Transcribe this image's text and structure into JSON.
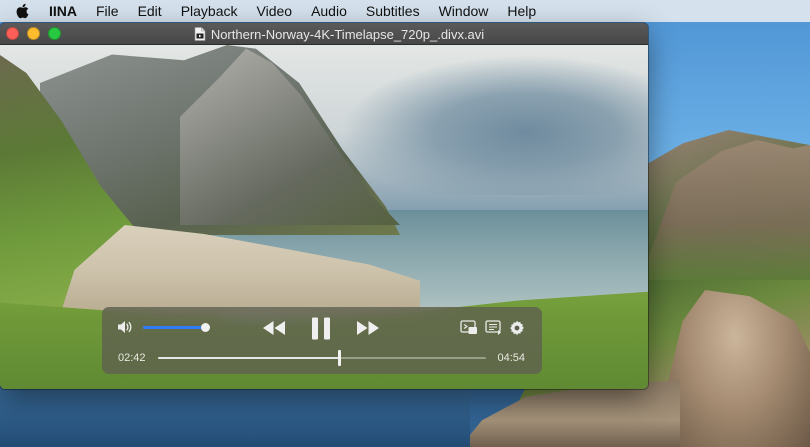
{
  "menubar": {
    "apple_icon": "apple-icon",
    "items": [
      {
        "label": "IINA",
        "app": true
      },
      {
        "label": "File"
      },
      {
        "label": "Edit"
      },
      {
        "label": "Playback"
      },
      {
        "label": "Video"
      },
      {
        "label": "Audio"
      },
      {
        "label": "Subtitles"
      },
      {
        "label": "Window"
      },
      {
        "label": "Help"
      }
    ]
  },
  "window": {
    "title": "Northern-Norway-4K-Timelapse_720p_.divx.avi",
    "title_icon": "document-icon",
    "traffic_lights": {
      "close": "#fc5f57",
      "minimize": "#fdbc2e",
      "zoom": "#28c840"
    }
  },
  "player": {
    "volume_level": 0.97,
    "volume_icon": "speaker-icon",
    "state": "playing",
    "controls": {
      "rewind_icon": "rewind-icon",
      "pause_icon": "pause-icon",
      "forward_icon": "fast-forward-icon",
      "pip_icon": "picture-in-picture-icon",
      "playlist_icon": "playlist-icon",
      "settings_icon": "gear-icon"
    },
    "time_elapsed": "02:42",
    "time_total": "04:54",
    "progress": 0.551,
    "accent_color": "#2f7cf6"
  }
}
